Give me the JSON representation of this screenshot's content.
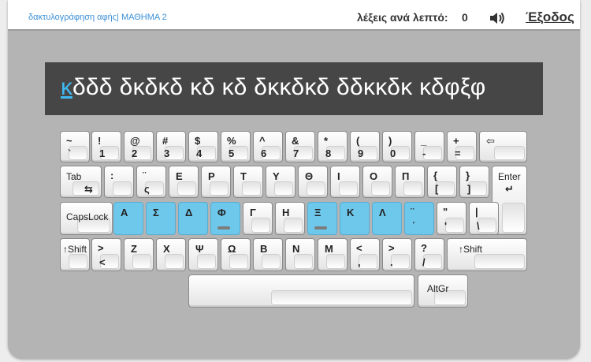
{
  "header": {
    "lesson": "δακτυλογράφηση αφής| ΜΑΘΗΜΑ 2",
    "wpm_label": "λέξεις ανά λεπτό:",
    "wpm_value": "0",
    "sound_icon": "speaker-icon",
    "exit": "Έξοδος"
  },
  "practice": {
    "current_char": "κ",
    "rest": "δδδ δκδκδ κδ κδ δκκδκδ δδκκδκ κδφξφ"
  },
  "keyboard": {
    "row1": [
      {
        "top": "~",
        "bottom": "`"
      },
      {
        "top": "!",
        "bottom": "1"
      },
      {
        "top": "@",
        "bottom": "2"
      },
      {
        "top": "#",
        "bottom": "3"
      },
      {
        "top": "$",
        "bottom": "4"
      },
      {
        "top": "%",
        "bottom": "5"
      },
      {
        "top": "^",
        "bottom": "6"
      },
      {
        "top": "&",
        "bottom": "7"
      },
      {
        "top": "*",
        "bottom": "8"
      },
      {
        "top": "(",
        "bottom": "9"
      },
      {
        "top": ")",
        "bottom": "0"
      },
      {
        "top": "_",
        "bottom": "-"
      },
      {
        "top": "+",
        "bottom": "="
      }
    ],
    "backspace": "⇦",
    "tab": "Tab",
    "tab_arrow": "⇆",
    "row2": [
      {
        "top": ":",
        "bottom": ""
      },
      {
        "top": "¨",
        "bottom": "ς"
      },
      {
        "c": "Ε"
      },
      {
        "c": "Ρ"
      },
      {
        "c": "Τ"
      },
      {
        "c": "Υ"
      },
      {
        "c": "Θ"
      },
      {
        "c": "Ι"
      },
      {
        "c": "Ο"
      },
      {
        "c": "Π"
      },
      {
        "top": "{",
        "bottom": "["
      },
      {
        "top": "}",
        "bottom": "]"
      }
    ],
    "enter": "Enter",
    "enter_arrow": "↵",
    "capslock": "CapsLock",
    "row3": [
      {
        "c": "Α"
      },
      {
        "c": "Σ"
      },
      {
        "c": "Δ"
      },
      {
        "c": "Φ"
      },
      {
        "c": "Γ"
      },
      {
        "c": "Η"
      },
      {
        "c": "Ξ"
      },
      {
        "c": "Κ"
      },
      {
        "c": "Λ"
      },
      {
        "top": "¨",
        "bottom": "΄"
      },
      {
        "top": "\"",
        "bottom": "'"
      },
      {
        "top": "|",
        "bottom": "\\"
      }
    ],
    "shift_left": "↑Shift",
    "row4": [
      {
        "top": ">",
        "bottom": "<"
      },
      {
        "c": "Ζ"
      },
      {
        "c": "Χ"
      },
      {
        "c": "Ψ"
      },
      {
        "c": "Ω"
      },
      {
        "c": "Β"
      },
      {
        "c": "Ν"
      },
      {
        "c": "Μ"
      },
      {
        "top": "<",
        "bottom": ","
      },
      {
        "top": ">",
        "bottom": "."
      },
      {
        "top": "?",
        "bottom": "/"
      }
    ],
    "shift_right": "↑Shift",
    "altgr": "AltGr",
    "highlight_color": "#6ec8ec"
  }
}
